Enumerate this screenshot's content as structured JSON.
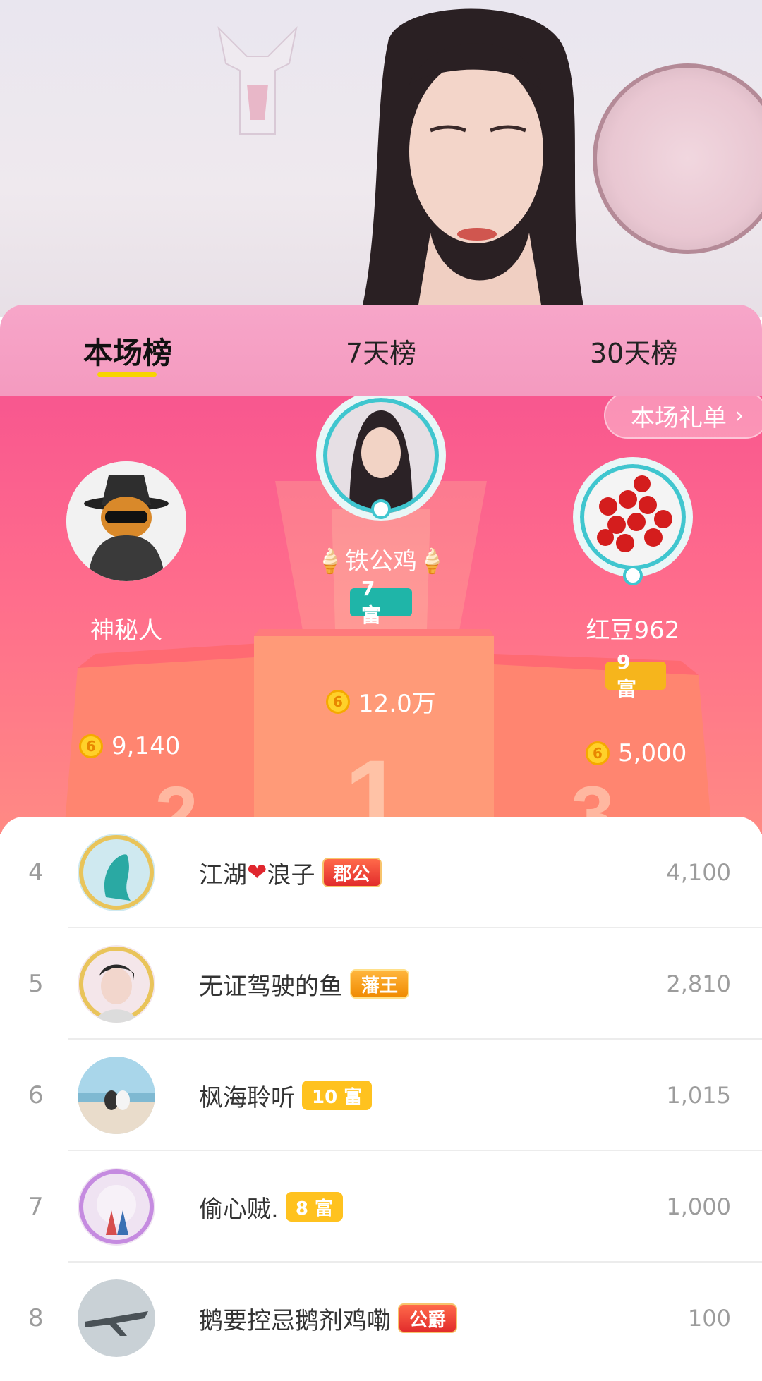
{
  "tabs": [
    {
      "label": "本场榜",
      "active": true
    },
    {
      "label": "7天榜",
      "active": false
    },
    {
      "label": "30天榜",
      "active": false
    }
  ],
  "gift_list_button": {
    "label": "本场礼单",
    "icon": "chevron-right-icon"
  },
  "podium": {
    "first": {
      "name": "铁公鸡",
      "level": "7 富",
      "level_color": "#1fb5a8",
      "score": "12.0万",
      "rank_label": "1"
    },
    "second": {
      "name": "神秘人",
      "score": "9,140",
      "rank_label": "2"
    },
    "third": {
      "name": "红豆962",
      "level": "9 富",
      "level_color": "#f6b51c",
      "score": "5,000",
      "rank_label": "3"
    },
    "coin_symbol": "6"
  },
  "rankings": [
    {
      "rank": "4",
      "name": "江湖",
      "name_suffix": "浪子",
      "heart": "❤",
      "tag": "郡公",
      "tag_style": "red",
      "score": "4,100"
    },
    {
      "rank": "5",
      "name": "无证驾驶的鱼",
      "tag": "藩王",
      "tag_style": "gold",
      "score": "2,810"
    },
    {
      "rank": "6",
      "name": "枫海聆听",
      "tag": "10 富",
      "tag_style": "yellow",
      "score": "1,015"
    },
    {
      "rank": "7",
      "name": "偷心贼.",
      "tag": "8 富",
      "tag_style": "yellow",
      "score": "1,000"
    },
    {
      "rank": "8",
      "name": "鹅要控忌鹅剂鸡嘞",
      "tag": "公爵",
      "tag_style": "red",
      "score": "100"
    }
  ],
  "colors": {
    "accent": "#f7d400",
    "podium_top": "#f8578f",
    "tab_bg": "#f7a6c9"
  }
}
